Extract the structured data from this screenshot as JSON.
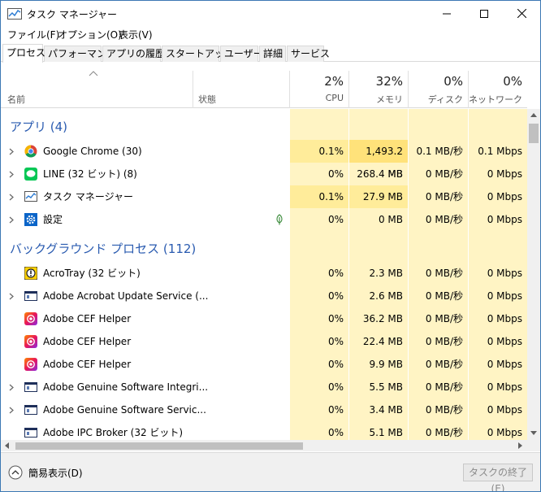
{
  "window": {
    "title": "タスク マネージャー"
  },
  "menu": [
    "ファイル(F)",
    "オプション(O)",
    "表示(V)"
  ],
  "tabs": [
    "プロセス",
    "パフォーマンス",
    "アプリの履歴",
    "スタートアップ",
    "ユーザー",
    "詳細",
    "サービス"
  ],
  "active_tab": "プロセス",
  "header": {
    "name": "名前",
    "status": "状態",
    "cpu": {
      "pct": "2%",
      "label": "CPU"
    },
    "memory": {
      "pct": "32%",
      "label": "メモリ"
    },
    "disk": {
      "pct": "0%",
      "label": "ディスク"
    },
    "network": {
      "pct": "0%",
      "label": "ネットワーク"
    }
  },
  "groups": {
    "apps": "アプリ (4)",
    "background": "バックグラウンド プロセス (112)"
  },
  "rows": [
    {
      "name": "Google Chrome (30)",
      "icon": "chrome-icon",
      "cpu": "0.1%",
      "mem": "1,493.2 MB",
      "disk": "0.1 MB/秒",
      "net": "0.1 Mbps",
      "expand": true
    },
    {
      "name": "LINE (32 ビット) (8)",
      "icon": "line-icon",
      "cpu": "0%",
      "mem": "268.4 MB",
      "disk": "0 MB/秒",
      "net": "0 Mbps",
      "expand": true
    },
    {
      "name": "タスク マネージャー",
      "icon": "task-manager-icon",
      "cpu": "0.1%",
      "mem": "27.9 MB",
      "disk": "0 MB/秒",
      "net": "0 Mbps",
      "expand": true
    },
    {
      "name": "設定",
      "icon": "gear-icon",
      "cpu": "0%",
      "mem": "0 MB",
      "disk": "0 MB/秒",
      "net": "0 Mbps",
      "expand": true
    },
    {
      "name": "AcroTray (32 ビット)",
      "icon": "acrotray-icon",
      "cpu": "0%",
      "mem": "2.3 MB",
      "disk": "0 MB/秒",
      "net": "0 Mbps",
      "expand": false
    },
    {
      "name": "Adobe Acrobat Update Service (...",
      "icon": "service-window-icon",
      "cpu": "0%",
      "mem": "2.6 MB",
      "disk": "0 MB/秒",
      "net": "0 Mbps",
      "expand": true
    },
    {
      "name": "Adobe CEF Helper",
      "icon": "adobe-cc-icon",
      "cpu": "0%",
      "mem": "36.2 MB",
      "disk": "0 MB/秒",
      "net": "0 Mbps",
      "expand": false
    },
    {
      "name": "Adobe CEF Helper",
      "icon": "adobe-cc-icon",
      "cpu": "0%",
      "mem": "22.4 MB",
      "disk": "0 MB/秒",
      "net": "0 Mbps",
      "expand": false
    },
    {
      "name": "Adobe CEF Helper",
      "icon": "adobe-cc-icon",
      "cpu": "0%",
      "mem": "9.9 MB",
      "disk": "0 MB/秒",
      "net": "0 Mbps",
      "expand": false
    },
    {
      "name": "Adobe Genuine Software Integri...",
      "icon": "service-window-icon",
      "cpu": "0%",
      "mem": "5.5 MB",
      "disk": "0 MB/秒",
      "net": "0 Mbps",
      "expand": true
    },
    {
      "name": "Adobe Genuine Software Servic...",
      "icon": "service-window-icon",
      "cpu": "0%",
      "mem": "3.4 MB",
      "disk": "0 MB/秒",
      "net": "0 Mbps",
      "expand": true
    },
    {
      "name": "Adobe IPC Broker (32 ビット)",
      "icon": "service-window-icon",
      "cpu": "0%",
      "mem": "5.1 MB",
      "disk": "0 MB/秒",
      "net": "0 Mbps",
      "expand": false
    }
  ],
  "footer": {
    "fewer_details": "簡易表示(D)",
    "end_task": "タスクの終了(E)"
  },
  "colors": {
    "heat_light": "#fff4c4",
    "heat_mid": "#ffec9a",
    "group_blue": "#2a5bb0"
  }
}
